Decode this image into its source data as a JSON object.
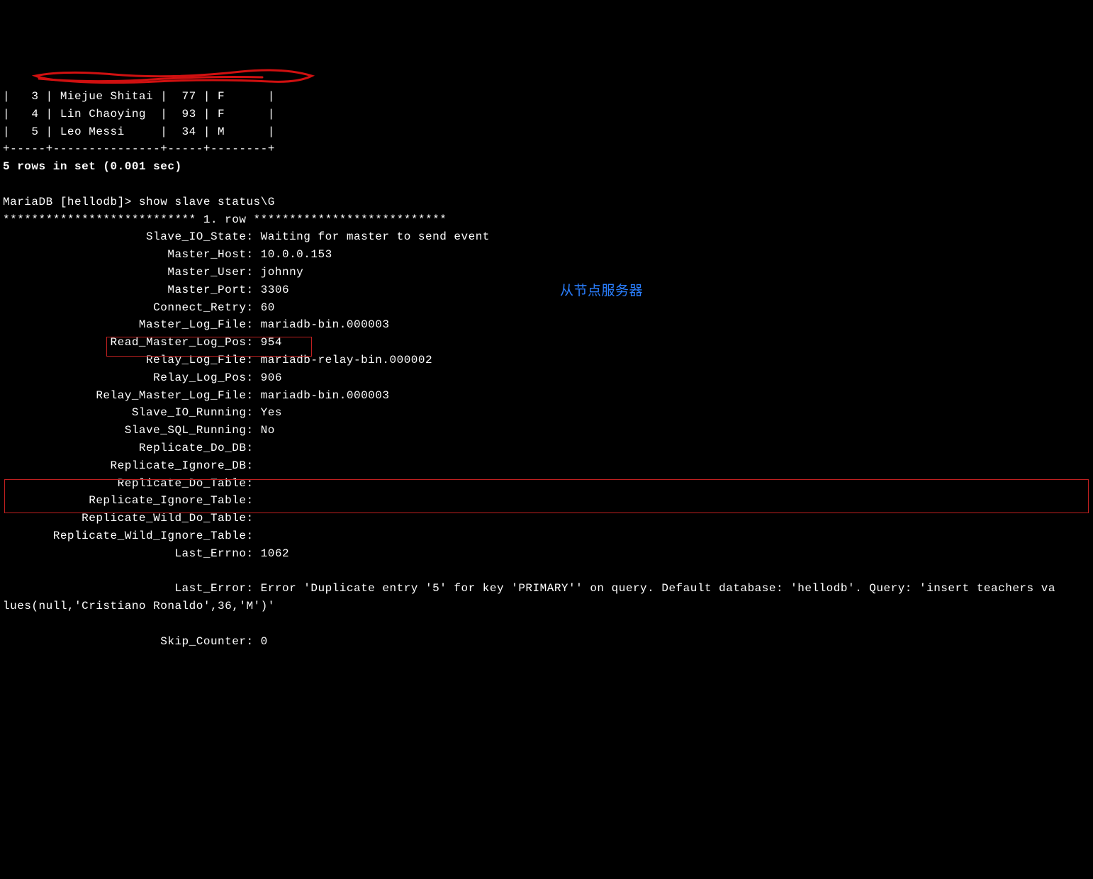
{
  "table_rows": [
    "|   3 | Miejue Shitai |  77 | F      |",
    "|   4 | Lin Chaoying  |  93 | F      |",
    "|   5 | Leo Messi     |  34 | M      |"
  ],
  "table_sep": "+-----+---------------+-----+--------+",
  "rows_status": "5 rows in set (0.001 sec)",
  "blank1": "",
  "prompt_line": "MariaDB [hellodb]> show slave status\\G",
  "row_header": "*************************** 1. row ***************************",
  "status_fields": [
    {
      "label": "Slave_IO_State",
      "value": "Waiting for master to send event"
    },
    {
      "label": "Master_Host",
      "value": "10.0.0.153"
    },
    {
      "label": "Master_User",
      "value": "johnny"
    },
    {
      "label": "Master_Port",
      "value": "3306"
    },
    {
      "label": "Connect_Retry",
      "value": "60"
    },
    {
      "label": "Master_Log_File",
      "value": "mariadb-bin.000003"
    },
    {
      "label": "Read_Master_Log_Pos",
      "value": "954"
    },
    {
      "label": "Relay_Log_File",
      "value": "mariadb-relay-bin.000002"
    },
    {
      "label": "Relay_Log_Pos",
      "value": "906"
    },
    {
      "label": "Relay_Master_Log_File",
      "value": "mariadb-bin.000003"
    },
    {
      "label": "Slave_IO_Running",
      "value": "Yes"
    },
    {
      "label": "Slave_SQL_Running",
      "value": "No"
    },
    {
      "label": "Replicate_Do_DB",
      "value": ""
    },
    {
      "label": "Replicate_Ignore_DB",
      "value": ""
    },
    {
      "label": "Replicate_Do_Table",
      "value": ""
    },
    {
      "label": "Replicate_Ignore_Table",
      "value": ""
    },
    {
      "label": "Replicate_Wild_Do_Table",
      "value": ""
    },
    {
      "label": "Replicate_Wild_Ignore_Table",
      "value": ""
    },
    {
      "label": "Last_Errno",
      "value": "1062"
    }
  ],
  "last_error_label": "Last_Error",
  "last_error_value": "Error 'Duplicate entry '5' for key 'PRIMARY'' on query. Default database: 'hellodb'. Query: 'insert teachers values(null,'Cristiano Ronaldo',36,'M')'",
  "skip_counter": {
    "label": "Skip_Counter",
    "value": "0"
  },
  "annotation_text": "从节点服务器",
  "label_width": 34
}
